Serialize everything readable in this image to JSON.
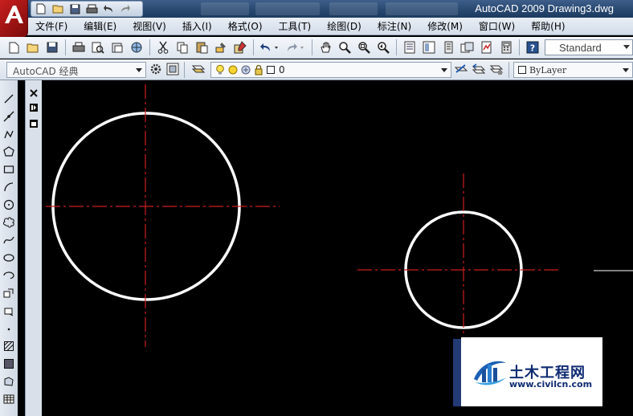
{
  "window": {
    "title": "AutoCAD 2009 Drawing3.dwg"
  },
  "menu": [
    {
      "label": "文件(F)"
    },
    {
      "label": "编辑(E)"
    },
    {
      "label": "视图(V)"
    },
    {
      "label": "插入(I)"
    },
    {
      "label": "格式(O)"
    },
    {
      "label": "工具(T)"
    },
    {
      "label": "绘图(D)"
    },
    {
      "label": "标注(N)"
    },
    {
      "label": "修改(M)"
    },
    {
      "label": "窗口(W)"
    },
    {
      "label": "帮助(H)"
    }
  ],
  "toolbar": {
    "text_style": "Standard"
  },
  "properties": {
    "workspace": "AutoCAD 经典",
    "layer": "0",
    "color": "ByLayer"
  },
  "watermark": {
    "title": "土木工程网",
    "url": "www.civilcn.com"
  },
  "colors": {
    "canvas": "#000000",
    "circle": "#ffffff",
    "centerline": "#cc1f1f"
  }
}
